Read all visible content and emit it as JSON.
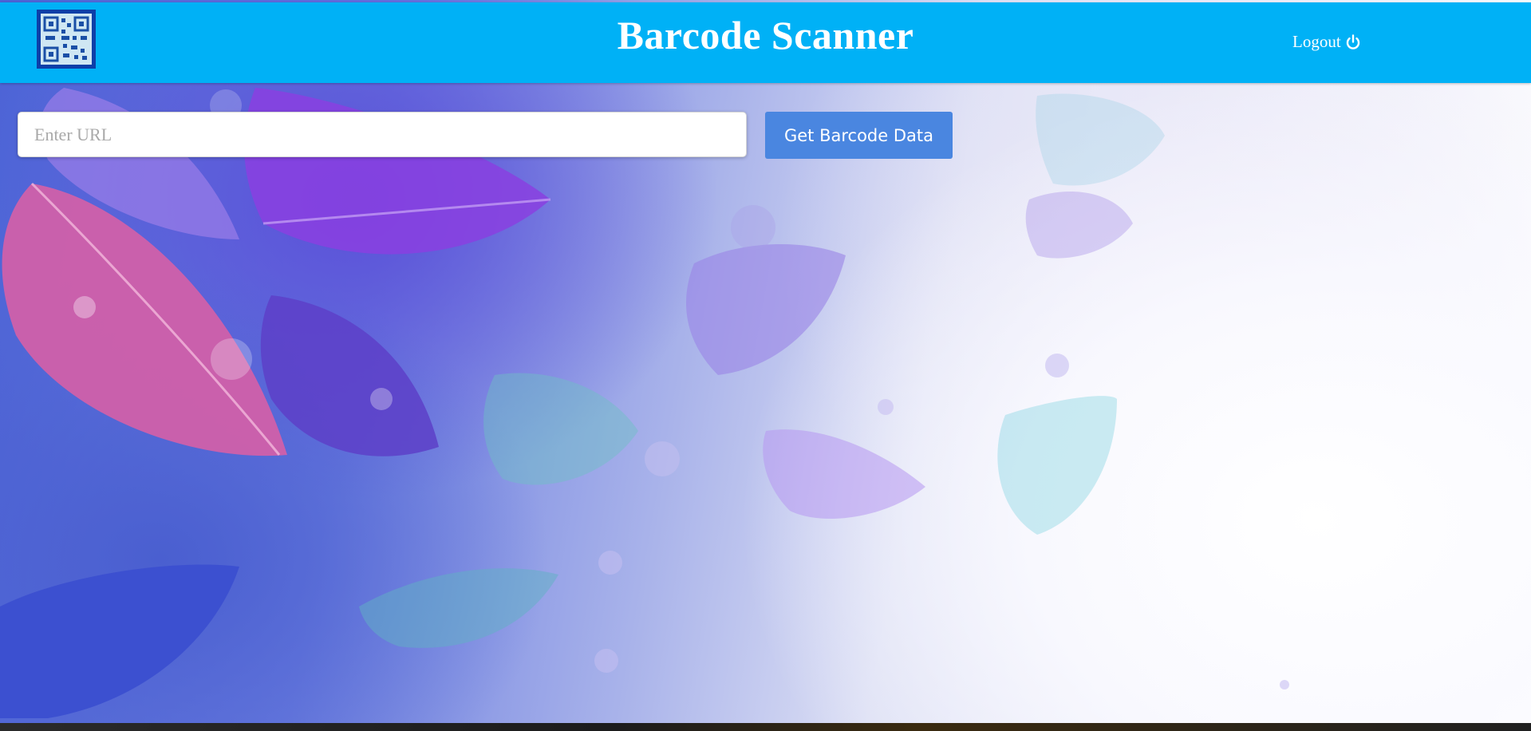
{
  "header": {
    "title": "Barcode Scanner",
    "logout_label": "Logout",
    "logout_icon": "power-icon",
    "logo_icon": "qr-code-icon",
    "background_color": "#00b1f6"
  },
  "search": {
    "placeholder": "Enter URL",
    "value": "",
    "button_label": "Get Barcode Data",
    "button_color": "#4a86e0"
  },
  "background": {
    "description_icon": "leaves-watercolor-background"
  }
}
